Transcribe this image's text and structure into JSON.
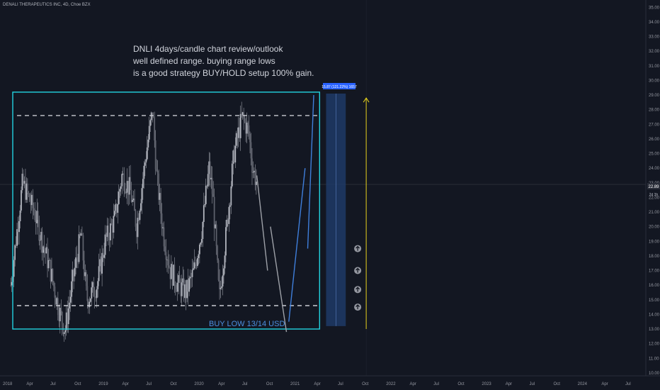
{
  "header": {
    "title": "DENALI THERAPEUTICS INC, 4D, Choe BZX"
  },
  "annotation": {
    "lines": [
      "DNLI 4days/candle chart review/outlook",
      "well defined range. buying range lows",
      "is a good strategy BUY/HOLD setup 100% gain."
    ],
    "buy_label": "BUY LOW 13/14 USD",
    "measure_label": "15.87 (121.22%) 1657"
  },
  "price_axis": {
    "ticks": [
      "35.00",
      "34.00",
      "33.00",
      "32.00",
      "31.00",
      "30.00",
      "29.00",
      "28.00",
      "27.00",
      "26.00",
      "25.00",
      "24.00",
      "23.00",
      "22.00",
      "21.00",
      "20.00",
      "19.00",
      "18.00",
      "17.00",
      "16.00",
      "15.00",
      "14.00",
      "13.00",
      "12.00",
      "11.00",
      "10.00"
    ],
    "tick_values": [
      35,
      34,
      33,
      32,
      31,
      30,
      29,
      28,
      27,
      26,
      25,
      24,
      23,
      22,
      21,
      20,
      19,
      18,
      17,
      16,
      15,
      14,
      13,
      12,
      11,
      10
    ],
    "last_price_label": "22.89",
    "countdown_label": "2d 3h"
  },
  "time_axis": {
    "ticks": [
      "2018",
      "Apr",
      "Jul",
      "Oct",
      "2019",
      "Apr",
      "Jul",
      "Oct",
      "2020",
      "Apr",
      "Jul",
      "Oct",
      "2021",
      "Apr",
      "Jul",
      "Oct",
      "2022",
      "Apr",
      "Jul",
      "Oct",
      "2023",
      "Apr",
      "Jul",
      "Oct",
      "2024",
      "Apr",
      "Jul"
    ]
  },
  "colors": {
    "background": "#131722",
    "candles": "#b2b5be",
    "range_box": "#22d3e0",
    "dashed_levels": "#c9cbd1",
    "projection_down": "#9ea1a8",
    "projection_up": "#3f7fdc",
    "target_arrow": "#e6d21c",
    "measure_box": "#1e3a66",
    "measure_label_bg": "#2962ff",
    "arrow_up_icons": "#9598a1"
  },
  "icons": [
    "arrow-up-circle-icon",
    "arrow-up-circle-icon",
    "arrow-up-circle-icon",
    "arrow-up-circle-icon"
  ],
  "chart_data": {
    "type": "candlestick",
    "ylim": [
      9.8,
      35.5
    ],
    "xlim": [
      "2018-01-01",
      "2024-09-01"
    ],
    "range_levels": {
      "resistance": 27.6,
      "support": 14.6
    },
    "range_box": {
      "top": 29.2,
      "bottom": 13.0,
      "start": "2018-01-01",
      "end": "2021-04-01"
    },
    "last_price": 22.89,
    "price_path": [
      [
        "2018-01-15",
        16.0
      ],
      [
        "2018-03-01",
        23.0
      ],
      [
        "2018-04-15",
        21.0
      ],
      [
        "2018-05-15",
        19.0
      ],
      [
        "2018-06-15",
        17.0
      ],
      [
        "2018-07-15",
        14.5
      ],
      [
        "2018-08-10",
        12.9
      ],
      [
        "2018-09-10",
        16.5
      ],
      [
        "2018-10-10",
        19.5
      ],
      [
        "2018-11-01",
        15.0
      ],
      [
        "2018-12-10",
        16.0
      ],
      [
        "2019-01-10",
        19.0
      ],
      [
        "2019-02-15",
        20.5
      ],
      [
        "2019-03-15",
        23.5
      ],
      [
        "2019-04-15",
        22.5
      ],
      [
        "2019-05-10",
        20.0
      ],
      [
        "2019-06-15",
        25.0
      ],
      [
        "2019-07-10",
        28.0
      ],
      [
        "2019-07-25",
        23.5
      ],
      [
        "2019-08-20",
        19.5
      ],
      [
        "2019-09-15",
        17.0
      ],
      [
        "2019-10-15",
        16.0
      ],
      [
        "2019-11-15",
        15.5
      ],
      [
        "2019-12-15",
        17.0
      ],
      [
        "2020-01-15",
        20.0
      ],
      [
        "2020-02-10",
        24.0
      ],
      [
        "2020-02-25",
        22.0
      ],
      [
        "2020-03-20",
        15.0
      ],
      [
        "2020-04-15",
        19.5
      ],
      [
        "2020-05-15",
        25.0
      ],
      [
        "2020-06-15",
        27.5
      ],
      [
        "2020-07-10",
        26.5
      ],
      [
        "2020-07-25",
        24.0
      ],
      [
        "2020-08-10",
        23.0
      ]
    ],
    "projection_down": [
      [
        "2020-08-10",
        23.5
      ],
      [
        "2020-09-20",
        17.0
      ]
    ],
    "projection_down_2": [
      [
        "2020-10-01",
        20.0
      ],
      [
        "2020-12-01",
        12.8
      ]
    ],
    "projection_up": [
      [
        "2020-12-10",
        13.5
      ],
      [
        "2021-02-10",
        24.0
      ]
    ],
    "projection_up_2": [
      [
        "2021-02-20",
        18.5
      ],
      [
        "2021-03-15",
        29.0
      ]
    ],
    "target_arrow": {
      "date": "2021-10-01",
      "from": 13.0,
      "to": 28.8
    },
    "measure_box": {
      "start": "2021-05-01",
      "end": "2021-07-15",
      "top": 29.1,
      "bottom": 13.2
    },
    "up_arrows": [
      {
        "date": "2021-10-01",
        "price": 14.5
      },
      {
        "date": "2021-10-01",
        "price": 15.7
      },
      {
        "date": "2021-10-01",
        "price": 17.0
      },
      {
        "date": "2021-10-01",
        "price": 18.5
      }
    ]
  }
}
